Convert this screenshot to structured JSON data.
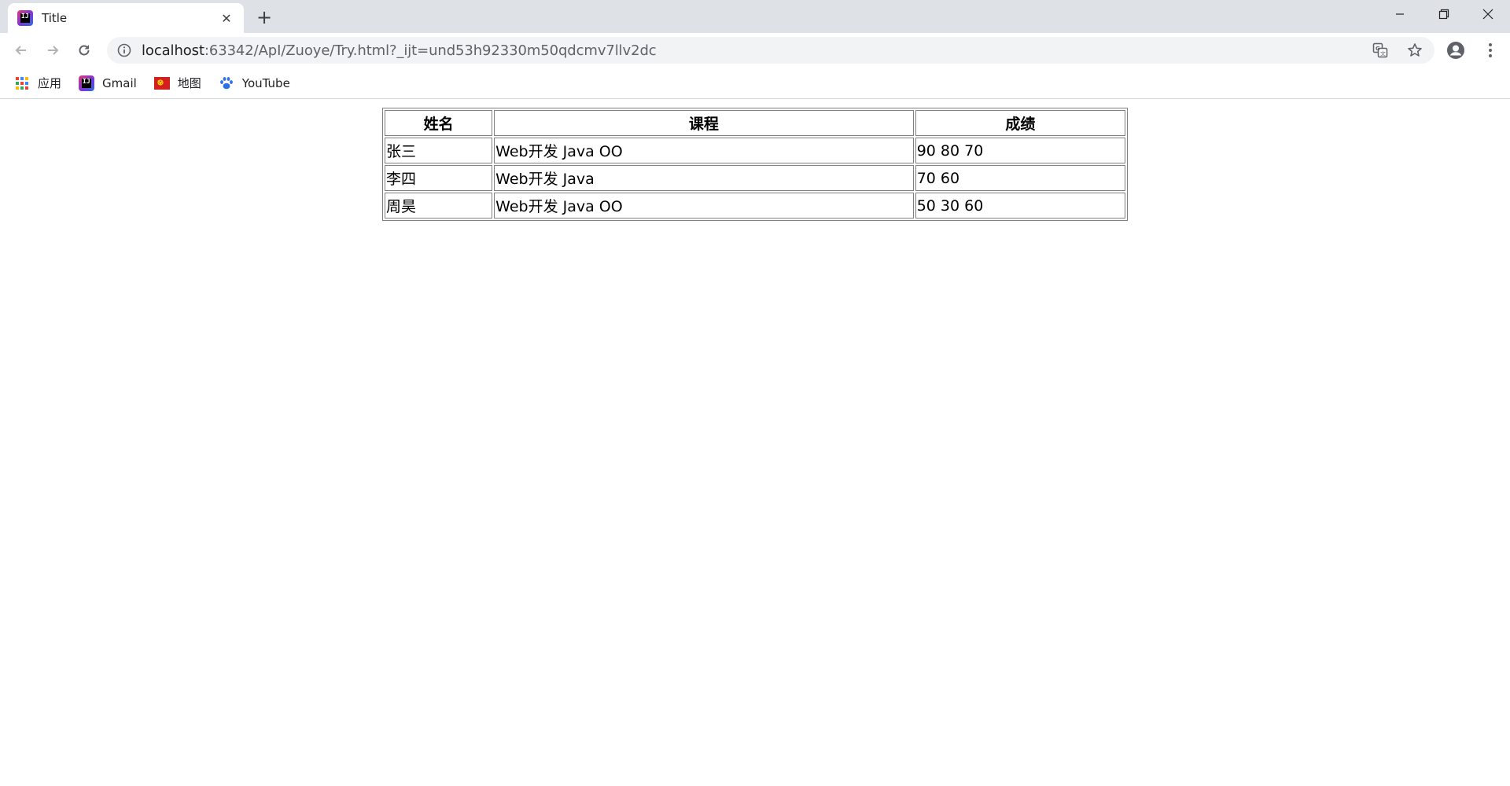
{
  "browser": {
    "tab": {
      "title": "Title",
      "close_glyph": "✕"
    },
    "new_tab_glyph": "+",
    "address": {
      "host": "localhost",
      "rest": ":63342/ApI/Zuoye/Try.html?_ijt=und53h92330m50qdcmv7llv2dc"
    },
    "bookmarks": [
      {
        "label": "应用",
        "icon": "apps-grid-icon"
      },
      {
        "label": "Gmail",
        "icon": "intellij-icon"
      },
      {
        "label": "地图",
        "icon": "flag-icon"
      },
      {
        "label": "YouTube",
        "icon": "paw-icon"
      }
    ],
    "colors": {
      "tabstrip": "#dee1e6",
      "omnibox": "#f1f3f4",
      "text": "#202124",
      "muted": "#5f6368"
    }
  },
  "page": {
    "table": {
      "headers": [
        "姓名",
        "课程",
        "成绩"
      ],
      "rows": [
        [
          "张三",
          "Web开发 Java OO",
          "90 80 70"
        ],
        [
          "李四",
          "Web开发 Java",
          "70 60"
        ],
        [
          "周昊",
          "Web开发 Java OO",
          "50 30 60"
        ]
      ]
    }
  }
}
